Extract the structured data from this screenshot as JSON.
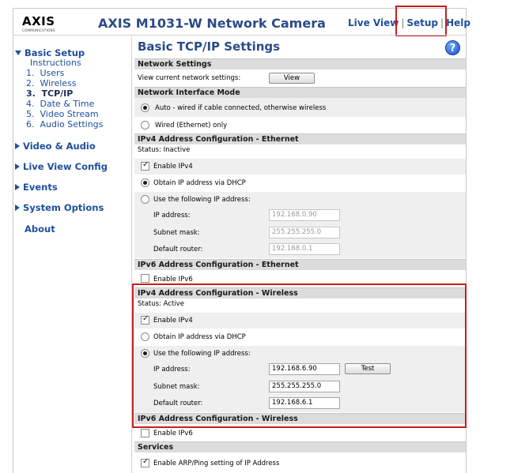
{
  "header": {
    "logo_text": "AXIS",
    "logo_subtext": "COMMUNICATIONS",
    "camera_title": "AXIS M1031-W Network Camera",
    "nav": {
      "live_view": "Live View",
      "setup": "Setup",
      "help": "Help",
      "separator": "|"
    }
  },
  "sidebar": {
    "basic_setup": "Basic Setup",
    "instructions": "Instructions",
    "items": [
      {
        "num": "1.",
        "label": "Users"
      },
      {
        "num": "2.",
        "label": "Wireless"
      },
      {
        "num": "3.",
        "label": "TCP/IP"
      },
      {
        "num": "4.",
        "label": "Date & Time"
      },
      {
        "num": "5.",
        "label": "Video Stream"
      },
      {
        "num": "6.",
        "label": "Audio Settings"
      }
    ],
    "sections": [
      "Video & Audio",
      "Live View Config",
      "Events",
      "System Options"
    ],
    "about": "About"
  },
  "main": {
    "title": "Basic TCP/IP Settings",
    "help_icon": "?",
    "network_settings": {
      "header": "Network Settings",
      "view_label": "View current network settings:",
      "view_button": "View"
    },
    "interface_mode": {
      "header": "Network Interface Mode",
      "auto": "Auto - wired if cable connected, otherwise wireless",
      "wired": "Wired (Ethernet) only",
      "selected": "auto"
    },
    "ipv4_ethernet": {
      "header": "IPv4 Address Configuration - Ethernet",
      "status": "Status: Inactive",
      "enable": "Enable IPv4",
      "dhcp": "Obtain IP address via DHCP",
      "static": "Use the following IP address:",
      "ip_label": "IP address:",
      "ip_value": "192.168.0.90",
      "mask_label": "Subnet mask:",
      "mask_value": "255.255.255.0",
      "router_label": "Default router:",
      "router_value": "192.168.0.1"
    },
    "ipv6_ethernet": {
      "header": "IPv6 Address Configuration - Ethernet",
      "enable": "Enable IPv6"
    },
    "ipv4_wireless": {
      "header": "IPv4 Address Configuration - Wireless",
      "status": "Status: Active",
      "enable": "Enable IPv4",
      "dhcp": "Obtain IP address via DHCP",
      "static": "Use the following IP address:",
      "ip_label": "IP address:",
      "ip_value": "192.168.6.90",
      "test_button": "Test",
      "mask_label": "Subnet mask:",
      "mask_value": "255.255.255.0",
      "router_label": "Default router:",
      "router_value": "192.168.6.1"
    },
    "ipv6_wireless": {
      "header": "IPv6 Address Configuration - Wireless",
      "enable": "Enable IPv6"
    },
    "services": {
      "header": "Services",
      "arp_ping": "Enable ARP/Ping setting of IP Address"
    }
  },
  "colors": {
    "accent": "#1f4f9c",
    "title": "#2b4a86",
    "highlight": "#c81e1e",
    "section_bg": "#dcdcdc"
  }
}
